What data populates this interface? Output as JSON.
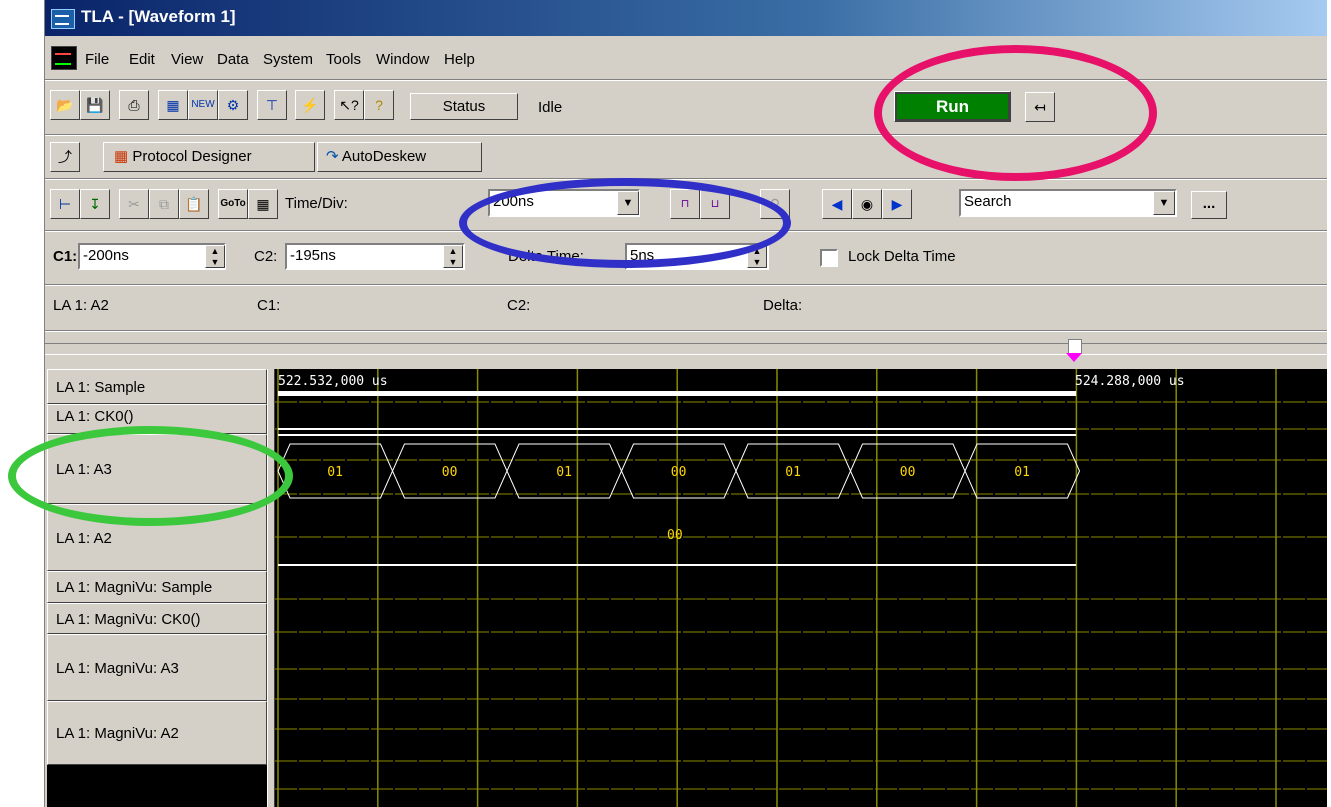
{
  "window": {
    "title": "TLA - [Waveform 1]"
  },
  "menu": [
    "File",
    "Edit",
    "View",
    "Data",
    "System",
    "Tools",
    "Window",
    "Help"
  ],
  "toolbar": {
    "status_label": "Status",
    "status_value": "Idle",
    "run_label": "Run"
  },
  "tabs": {
    "protocol_designer": "Protocol Designer",
    "autodeskew": "AutoDeskew"
  },
  "waveform_toolbar": {
    "time_div_label": "Time/Div:",
    "time_div_value": "200ns",
    "search_value": "Search",
    "more_label": "..."
  },
  "cursor_bar": {
    "c1_label": "C1:",
    "c1_value": "-200ns",
    "c2_label": "C2:",
    "c2_value": "-195ns",
    "delta_label": "Delta Time:",
    "delta_value": "5ns",
    "lock_label": "Lock Delta Time"
  },
  "readout": {
    "signal": "LA 1: A2",
    "c1_label": "C1:",
    "c2_label": "C2:",
    "delta_label": "Delta:"
  },
  "signals": [
    "LA 1: Sample",
    "LA 1: CK0()",
    "LA 1: A3",
    "LA 1: A2",
    "LA 1: MagniVu: Sample",
    "LA 1: MagniVu: CK0()",
    "LA 1: MagniVu: A3",
    "LA 1: MagniVu: A2"
  ],
  "timestamps": {
    "left": "522.532,000 us",
    "right": "524.288,000 us"
  },
  "a3_bus_values": [
    "01",
    "00",
    "01",
    "00",
    "01",
    "00",
    "01"
  ],
  "a2_bus_value": "00",
  "colors": {
    "waveform_bg": "#000000",
    "grid": "#8a8a00",
    "bus_text": "#ffd700",
    "run_green": "#008000",
    "annot_pink": "#e8116a",
    "annot_blue": "#3030c8",
    "annot_green": "#3cc83c"
  }
}
